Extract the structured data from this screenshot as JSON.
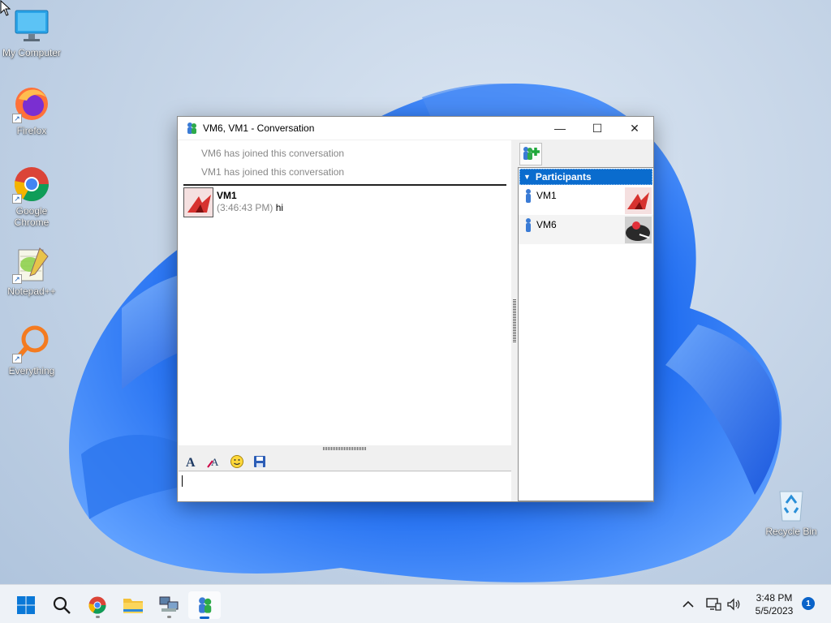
{
  "desktop": {
    "icons": [
      {
        "label": "My Computer"
      },
      {
        "label": "Firefox"
      },
      {
        "label": "Google Chrome"
      },
      {
        "label": "Notepad++"
      },
      {
        "label": "Everything"
      },
      {
        "label": "Recycle Bin"
      }
    ]
  },
  "window": {
    "title": "VM6, VM1 - Conversation",
    "controls": {
      "minimize": "—",
      "maximize": "☐",
      "close": "✕"
    }
  },
  "chat": {
    "system_messages": [
      "VM6 has joined this conversation",
      "VM1 has joined this conversation"
    ],
    "messages": [
      {
        "sender": "VM1",
        "time": "(3:46:43 PM)",
        "text": "hi"
      }
    ]
  },
  "participants": {
    "header": "Participants",
    "list": [
      {
        "name": "VM1"
      },
      {
        "name": "VM6"
      }
    ]
  },
  "taskbar": {
    "clock_time": "3:48 PM",
    "clock_date": "5/5/2023",
    "notification_count": "1"
  },
  "colors": {
    "accent": "#0a6cce",
    "wallpaper_blue": "#1a5fe0"
  }
}
